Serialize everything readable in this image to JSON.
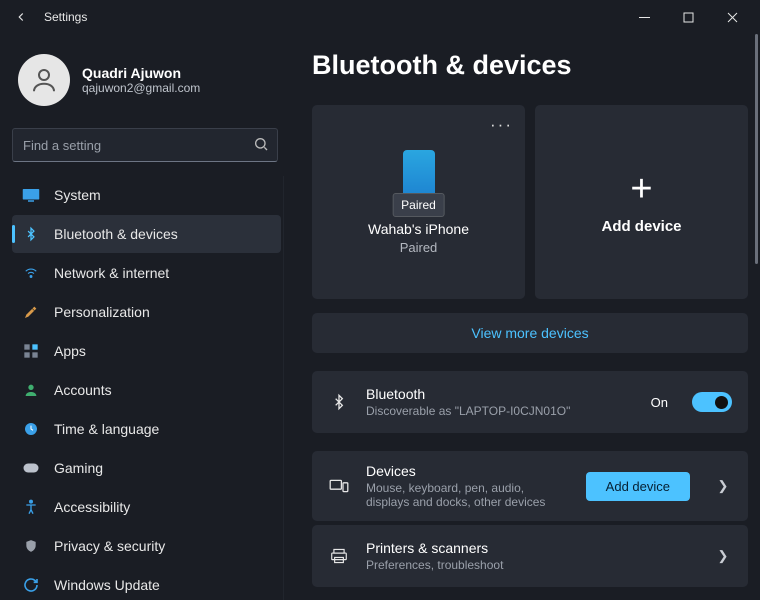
{
  "window": {
    "title": "Settings"
  },
  "user": {
    "name": "Quadri Ajuwon",
    "email": "qajuwon2@gmail.com"
  },
  "search": {
    "placeholder": "Find a setting"
  },
  "nav": {
    "items": [
      {
        "label": "System"
      },
      {
        "label": "Bluetooth & devices"
      },
      {
        "label": "Network & internet"
      },
      {
        "label": "Personalization"
      },
      {
        "label": "Apps"
      },
      {
        "label": "Accounts"
      },
      {
        "label": "Time & language"
      },
      {
        "label": "Gaming"
      },
      {
        "label": "Accessibility"
      },
      {
        "label": "Privacy & security"
      },
      {
        "label": "Windows Update"
      }
    ]
  },
  "page": {
    "title": "Bluetooth & devices",
    "device": {
      "name": "Wahab's iPhone",
      "status": "Paired",
      "tooltip": "Paired"
    },
    "add_tile": "Add device",
    "more_devices": "View more devices",
    "bt_row": {
      "title": "Bluetooth",
      "sub": "Discoverable as \"LAPTOP-I0CJN01O\"",
      "state": "On"
    },
    "devices_row": {
      "title": "Devices",
      "sub": "Mouse, keyboard, pen, audio, displays and docks, other devices",
      "button": "Add device"
    },
    "printers_row": {
      "title": "Printers & scanners",
      "sub": "Preferences, troubleshoot"
    }
  },
  "colors": {
    "accent": "#4cc2ff"
  }
}
